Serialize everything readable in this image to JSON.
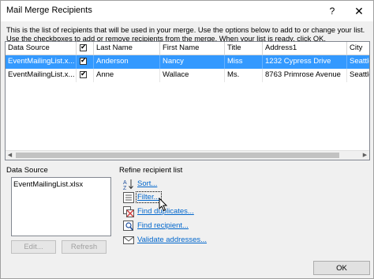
{
  "window": {
    "title": "Mail Merge Recipients",
    "help": "?",
    "close": "✕"
  },
  "description": [
    "This is the list of recipients that will be used in your merge.  Use the options below to add to or change your list.",
    "Use the checkboxes to add or remove recipients from the merge.  When your list is ready, click OK."
  ],
  "grid": {
    "columns": [
      "Data Source",
      "",
      "Last Name",
      "First Name",
      "Title",
      "Address1",
      "City"
    ],
    "rows": [
      {
        "source": "EventMailingList.x...",
        "checked": true,
        "last": "Anderson",
        "first": "Nancy",
        "title": "Miss",
        "address": "1232 Cypress Drive",
        "city": "Seattle"
      },
      {
        "source": "EventMailingList.x...",
        "checked": true,
        "last": "Anne",
        "first": "Wallace",
        "title": "Ms.",
        "address": "8763 Primrose Avenue",
        "city": "Seattle"
      }
    ]
  },
  "data_source_panel": {
    "label": "Data Source",
    "items": [
      "EventMailingList.xlsx"
    ],
    "edit": "Edit...",
    "refresh": "Refresh"
  },
  "refine": {
    "label": "Refine recipient list",
    "sort": "Sort...",
    "filter": "Filter...",
    "duplicates": "Find duplicates...",
    "recipient": "Find recipient...",
    "validate": "Validate addresses..."
  },
  "ok": "OK",
  "colors": {
    "selection": "#3399ff",
    "link": "#0066cc"
  }
}
